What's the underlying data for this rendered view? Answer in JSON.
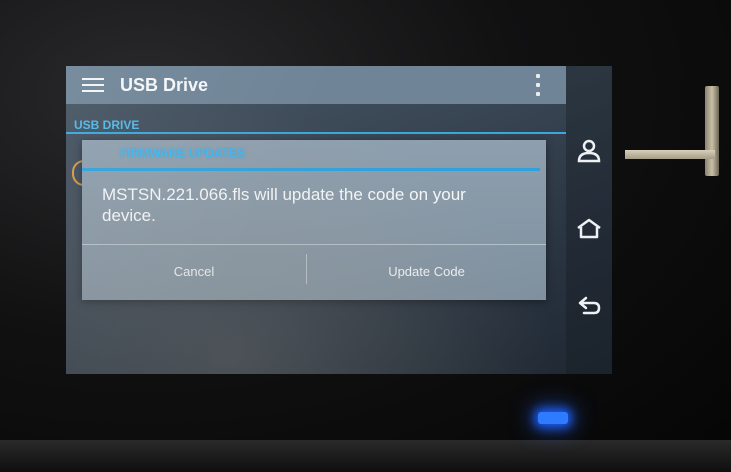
{
  "app_bar": {
    "title": "USB Drive",
    "menu_icon": "hamburger-menu-icon",
    "overflow_icon": "overflow-menu-icon"
  },
  "section": {
    "label": "USB DRIVE"
  },
  "dialog": {
    "title": "FIRMWARE UPDATES",
    "message": "MSTSN.221.066.fls will update the code on your device.",
    "cancel_label": "Cancel",
    "confirm_label": "Update Code"
  },
  "nav_bar": {
    "items": [
      {
        "icon": "user-icon"
      },
      {
        "icon": "home-icon"
      },
      {
        "icon": "back-icon"
      }
    ]
  },
  "colors": {
    "accent": "#3aa8dc",
    "app_bar": "#6f8597",
    "dialog_bg": "#8e9fae",
    "led": "#2f7bff"
  }
}
